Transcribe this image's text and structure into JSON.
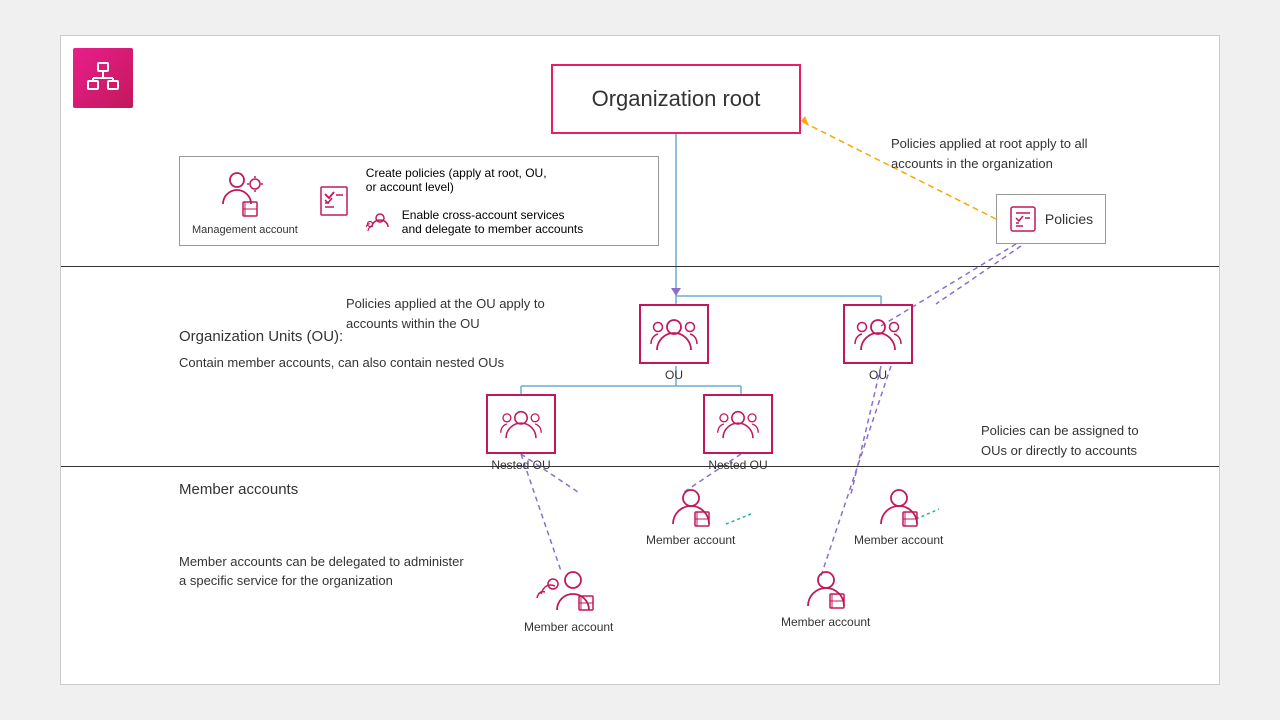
{
  "logo": {
    "alt": "AWS Organizations icon"
  },
  "org_root": {
    "label": "Organization root"
  },
  "policies_note_1": "Policies applied at root apply to all\naccounts in the organization",
  "policies_label": "Policies",
  "mgmt_account_label": "Management account",
  "mgmt_bullets": [
    "Create policies (apply at root, OU,\nor account level)",
    "Enable cross-account services\nand delegate to member accounts"
  ],
  "ou_section": {
    "title": "Organization Units (OU):",
    "desc": "Contain member accounts, can also\ncontain nested OUs",
    "note": "Policies applied at the OU apply to\naccounts within the OU",
    "note2": "Policies can be assigned to\nOUs or directly to accounts"
  },
  "member_section": {
    "title": "Member accounts",
    "desc": "Member accounts can be delegated to administer\na specific service for the organization"
  },
  "nodes": {
    "ou1_label": "OU",
    "ou2_label": "OU",
    "nested_ou1_label": "Nested OU",
    "nested_ou2_label": "Nested OU",
    "member1_label": "Member account",
    "member2_label": "Member account",
    "member3_label": "Member account",
    "member4_label": "Member account"
  }
}
